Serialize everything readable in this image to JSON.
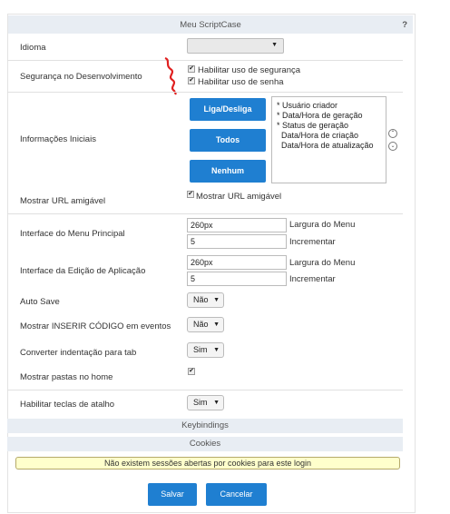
{
  "header": {
    "title": "Meu ScriptCase",
    "help": "?"
  },
  "rows": {
    "idioma": {
      "label": "Idioma"
    },
    "seguranca": {
      "label": "Segurança no Desenvolvimento",
      "opt1": "Habilitar uso de segurança",
      "opt2": "Habilitar uso de senha"
    },
    "info": {
      "label": "Informações Iniciais",
      "btn_toggle": "Liga/Desliga",
      "btn_all": "Todos",
      "btn_none": "Nenhum",
      "items": [
        "* Usuário criador",
        "* Data/Hora de geração",
        "* Status de geração",
        "Data/Hora de criação",
        "Data/Hora de atualização"
      ]
    },
    "url": {
      "label": "Mostrar URL amigável",
      "opt": "Mostrar URL amigável"
    },
    "menu": {
      "label": "Interface do Menu Principal",
      "width_value": "260px",
      "width_label": "Largura do Menu",
      "inc_value": "5",
      "inc_label": "Incrementar"
    },
    "edit": {
      "label": "Interface da Edição de Aplicação",
      "width_value": "260px",
      "width_label": "Largura do Menu",
      "inc_value": "5",
      "inc_label": "Incrementar"
    },
    "autosave": {
      "label": "Auto Save",
      "value": "Não"
    },
    "inserir": {
      "label": "Mostrar INSERIR CÓDIGO em eventos",
      "value": "Não"
    },
    "indent": {
      "label": "Converter indentação para tab",
      "value": "Sim"
    },
    "pastas": {
      "label": "Mostrar pastas no home"
    },
    "atalho": {
      "label": "Habilitar teclas de atalho",
      "value": "Sim"
    }
  },
  "sections": {
    "keybindings": "Keybindings",
    "cookies": "Cookies"
  },
  "notice": "Não existem sessões abertas por cookies para este login",
  "footer": {
    "save": "Salvar",
    "cancel": "Cancelar"
  },
  "colors": {
    "accent": "#1f7fd1",
    "band": "#e8edf3",
    "notice_bg": "#ffffcc"
  }
}
